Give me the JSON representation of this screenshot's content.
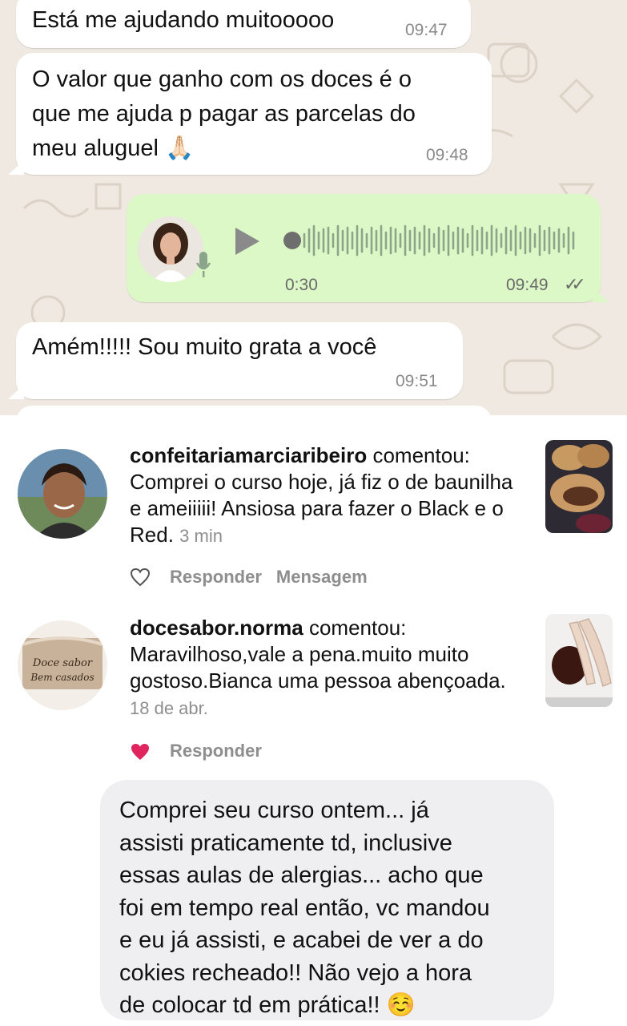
{
  "whatsapp": {
    "messages": [
      {
        "text": "Está me ajudando muitooooo",
        "time": "09:47"
      },
      {
        "text": "O valor que ganho com os doces é o\nque me ajuda p pagar as parcelas do\nmeu aluguel 🙏🏻",
        "time": "09:48"
      },
      {
        "text": "Amém!!!!! Sou muito grata a você",
        "time": "09:51"
      }
    ],
    "voice_note": {
      "duration": "0:30",
      "time": "09:49",
      "status": "✓✓"
    }
  },
  "instagram": {
    "comments": [
      {
        "username": "confeitariamarciaribeiro",
        "verb": "comentou:",
        "text": "Comprei o curso hoje, já fiz o de baunilha e ameiiiii! Ansiosa para fazer o Black e o Red.",
        "age": "3 min",
        "reply": "Responder",
        "message": "Mensagem",
        "liked": false
      },
      {
        "username": "docesabor.norma",
        "verb": "comentou:",
        "text": "Maravilhoso,vale a pena.muito muito gostoso.Bianca uma pessoa abençoada.",
        "age": "18 de abr.",
        "reply": "Responder",
        "liked": true,
        "avatar_text": [
          "Doce sabor",
          "Bem casados"
        ]
      }
    ],
    "like_color": "#e0245e"
  },
  "message_bubble": {
    "text": "Comprei seu curso ontem... já\nassisti praticamente td, inclusive\nessas aulas de alergias... acho que\nfoi em tempo real então, vc mandou\ne eu já assisti, e acabei de ver a do\ncokies  recheado!! Não vejo a hora\nde colocar td em prática!! ☺️"
  }
}
